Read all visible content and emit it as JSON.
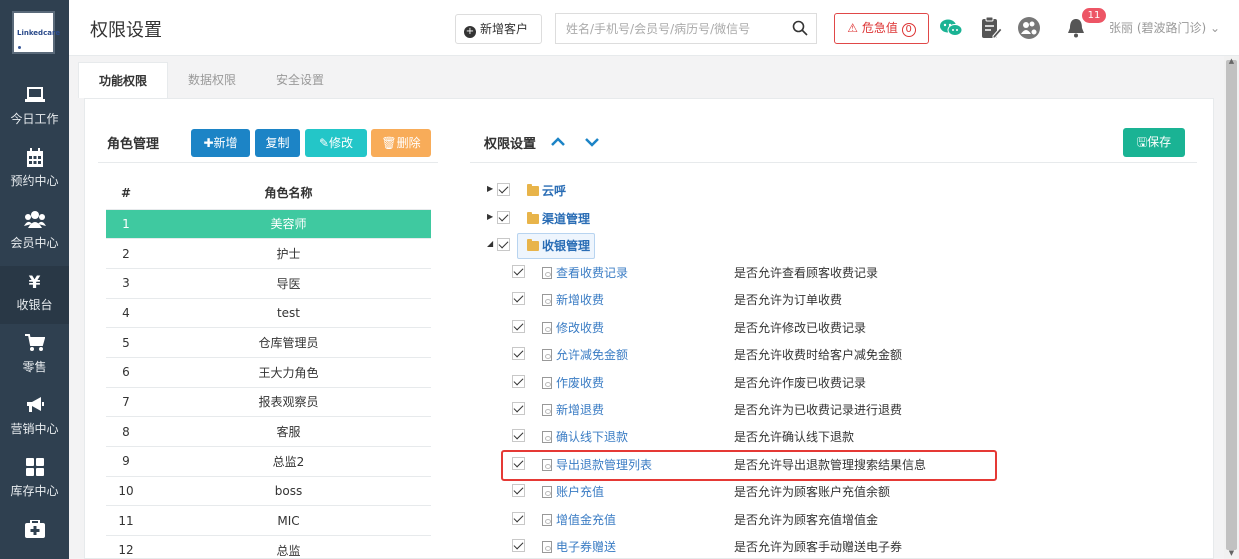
{
  "sidebar": {
    "logo_text": "Linkedcare",
    "items": [
      {
        "label": "今日工作",
        "icon": "laptop-icon"
      },
      {
        "label": "预约中心",
        "icon": "calendar-icon"
      },
      {
        "label": "会员中心",
        "icon": "users-icon"
      },
      {
        "label": "收银台",
        "icon": "yen-icon",
        "glyph": "¥"
      },
      {
        "label": "零售",
        "icon": "cart-icon"
      },
      {
        "label": "营销中心",
        "icon": "bullhorn-icon"
      },
      {
        "label": "库存中心",
        "icon": "grid-icon"
      },
      {
        "label": "",
        "icon": "medkit-icon"
      }
    ]
  },
  "header": {
    "title": "权限设置",
    "new_customer": "新增客户",
    "search_placeholder": "姓名/手机号/会员号/病历号/微信号",
    "urgent_label": "危急值",
    "urgent_count": "0",
    "notification_count": "11",
    "user": "张丽 (碧波路门诊)"
  },
  "tabs": [
    {
      "label": "功能权限",
      "active": true
    },
    {
      "label": "数据权限",
      "active": false
    },
    {
      "label": "安全设置",
      "active": false
    }
  ],
  "role_mgmt": {
    "title": "角色管理",
    "add": "新增",
    "copy": "复制",
    "edit": "修改",
    "delete": "删除",
    "col_index": "#",
    "col_name": "角色名称",
    "rows": [
      {
        "idx": "1",
        "name": "美容师"
      },
      {
        "idx": "2",
        "name": "护士"
      },
      {
        "idx": "3",
        "name": "导医"
      },
      {
        "idx": "4",
        "name": "test"
      },
      {
        "idx": "5",
        "name": "仓库管理员"
      },
      {
        "idx": "6",
        "name": "王大力角色"
      },
      {
        "idx": "7",
        "name": "报表观察员"
      },
      {
        "idx": "8",
        "name": "客服"
      },
      {
        "idx": "9",
        "name": "总监2"
      },
      {
        "idx": "10",
        "name": "boss"
      },
      {
        "idx": "11",
        "name": "MIC"
      },
      {
        "idx": "12",
        "name": "总监"
      }
    ],
    "selected_index": 0
  },
  "permissions": {
    "title": "权限设置",
    "save": "保存",
    "groups": [
      {
        "label": "云呼",
        "expanded": false
      },
      {
        "label": "渠道管理",
        "expanded": false
      },
      {
        "label": "收银管理",
        "expanded": true
      }
    ],
    "items": [
      {
        "label": "查看收费记录",
        "desc": "是否允许查看顾客收费记录"
      },
      {
        "label": "新增收费",
        "desc": "是否允许为订单收费"
      },
      {
        "label": "修改收费",
        "desc": "是否允许修改已收费记录"
      },
      {
        "label": "允许减免金额",
        "desc": "是否允许收费时给客户减免金额"
      },
      {
        "label": "作废收费",
        "desc": "是否允许作废已收费记录"
      },
      {
        "label": "新增退费",
        "desc": "是否允许为已收费记录进行退费"
      },
      {
        "label": "确认线下退款",
        "desc": "是否允许确认线下退款"
      },
      {
        "label": "导出退款管理列表",
        "desc": "是否允许导出退款管理搜索结果信息"
      },
      {
        "label": "账户充值",
        "desc": "是否允许为顾客账户充值余额"
      },
      {
        "label": "增值金充值",
        "desc": "是否允许为顾客充值增值金"
      },
      {
        "label": "电子券赠送",
        "desc": "是否允许为顾客手动赠送电子券"
      }
    ]
  },
  "colors": {
    "sidebar_bg": "#2f4050",
    "primary_blue": "#1c84c6",
    "teal": "#23c6c8",
    "orange": "#f8ac59",
    "green": "#1ab394",
    "selected_row": "#3fc9a0",
    "highlight": "#e53935"
  }
}
